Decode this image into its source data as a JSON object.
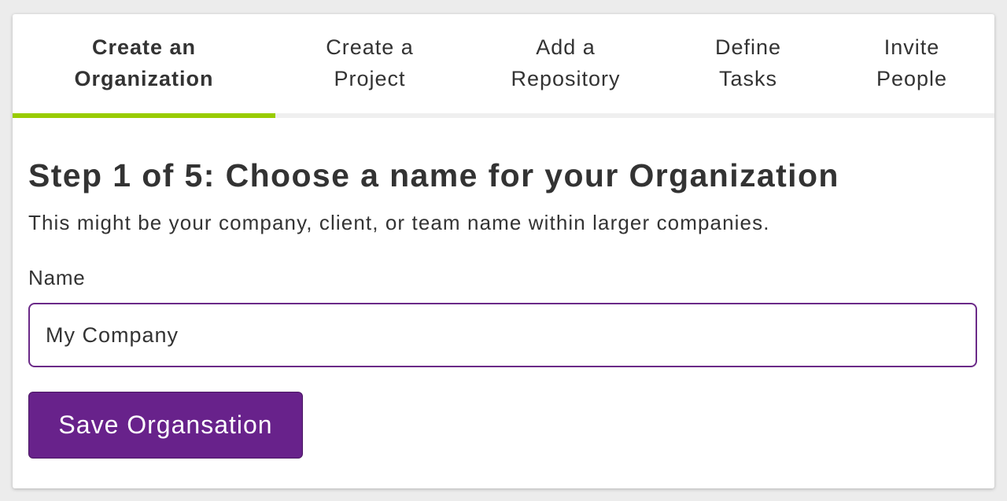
{
  "steps": [
    {
      "label": "Create an\nOrganization",
      "active": true
    },
    {
      "label": "Create a\nProject",
      "active": false
    },
    {
      "label": "Add a\nRepository",
      "active": false
    },
    {
      "label": "Define\nTasks",
      "active": false
    },
    {
      "label": "Invite\nPeople",
      "active": false
    }
  ],
  "main": {
    "heading": "Step 1 of 5: Choose a name for your Organization",
    "description": "This might be your company, client, or team name within larger companies.",
    "name_label": "Name",
    "name_value": "My Company",
    "save_label": "Save Organsation"
  },
  "colors": {
    "accent_purple": "#68228b",
    "progress_green": "#99cc00",
    "input_border": "#6b2a88",
    "text": "#333333"
  }
}
